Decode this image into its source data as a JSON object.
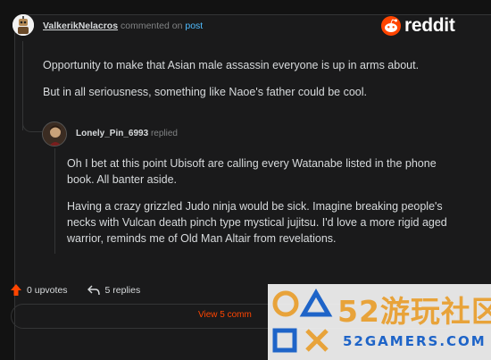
{
  "comment": {
    "author": "ValkerikNelacros",
    "verb": "commented on",
    "target_link": "post",
    "paragraphs": [
      "Opportunity to make that Asian male assassin everyone is up in arms about.",
      "But in all seriousness, something like Naoe's father could be cool."
    ]
  },
  "brand": {
    "name": "reddit",
    "accent_color": "#ff4500"
  },
  "reply": {
    "author": "Lonely_Pin_6993",
    "verb": "replied",
    "paragraphs": [
      "Oh I bet at this point Ubisoft are calling every Watanabe listed in the phone book. All banter aside.",
      "Having a crazy grizzled Judo ninja would be sick.   Imagine breaking people's necks with Vulcan death pinch type mystical jujitsu. I'd love a more rigid aged warrior, reminds me of Old Man Altair from revelations."
    ]
  },
  "footer": {
    "upvote_icon": "arrow-up-icon",
    "upvotes_label": "0 upvotes",
    "reply_icon": "reply-arrow-icon",
    "replies_label": "5 replies",
    "view_more_label": "View 5 comm"
  },
  "watermark": {
    "big_text": "52游玩社区",
    "small_text": "52GAMERS.COM",
    "colors": {
      "orange": "#e8a33a",
      "blue": "#1e64c8"
    }
  }
}
